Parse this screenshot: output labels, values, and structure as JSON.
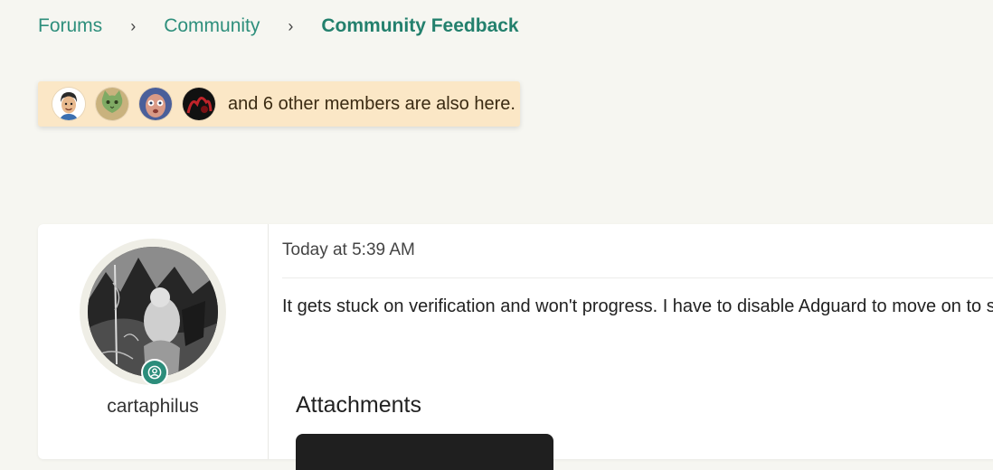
{
  "breadcrumb": {
    "items": [
      "Forums",
      "Community",
      "Community Feedback"
    ],
    "separator": "›"
  },
  "members_here": {
    "avatars": [
      "bitmoji-avatar-icon",
      "green-cat-avatar-icon",
      "face-photo-avatar-icon",
      "dark-red-avatar-icon"
    ],
    "text": "and 6 other members are also here."
  },
  "post": {
    "username": "cartaphilus",
    "online_badge_icon": "user-circle-icon",
    "timestamp": "Today at 5:39 AM",
    "body": "It gets stuck on verification and won't progress. I have to disable Adguard to move on to sites.",
    "attachments_label": "Attachments"
  },
  "colors": {
    "accent": "#2e8f7c",
    "page_background": "#f6f6f1",
    "notice_background": "#fbe7c6"
  }
}
